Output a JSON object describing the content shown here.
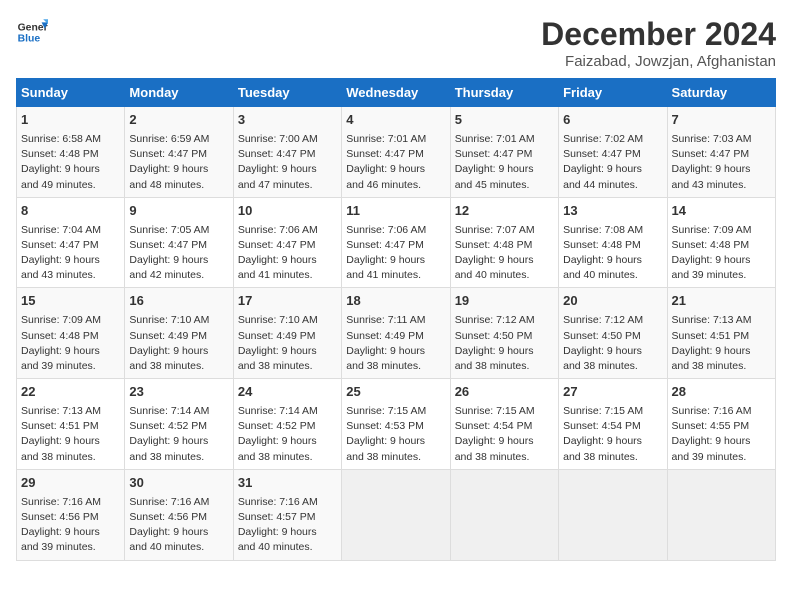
{
  "header": {
    "logo_general": "General",
    "logo_blue": "Blue",
    "title": "December 2024",
    "subtitle": "Faizabad, Jowzjan, Afghanistan"
  },
  "days_of_week": [
    "Sunday",
    "Monday",
    "Tuesday",
    "Wednesday",
    "Thursday",
    "Friday",
    "Saturday"
  ],
  "weeks": [
    [
      {
        "day": 1,
        "info": "Sunrise: 6:58 AM\nSunset: 4:48 PM\nDaylight: 9 hours\nand 49 minutes."
      },
      {
        "day": 2,
        "info": "Sunrise: 6:59 AM\nSunset: 4:47 PM\nDaylight: 9 hours\nand 48 minutes."
      },
      {
        "day": 3,
        "info": "Sunrise: 7:00 AM\nSunset: 4:47 PM\nDaylight: 9 hours\nand 47 minutes."
      },
      {
        "day": 4,
        "info": "Sunrise: 7:01 AM\nSunset: 4:47 PM\nDaylight: 9 hours\nand 46 minutes."
      },
      {
        "day": 5,
        "info": "Sunrise: 7:01 AM\nSunset: 4:47 PM\nDaylight: 9 hours\nand 45 minutes."
      },
      {
        "day": 6,
        "info": "Sunrise: 7:02 AM\nSunset: 4:47 PM\nDaylight: 9 hours\nand 44 minutes."
      },
      {
        "day": 7,
        "info": "Sunrise: 7:03 AM\nSunset: 4:47 PM\nDaylight: 9 hours\nand 43 minutes."
      }
    ],
    [
      {
        "day": 8,
        "info": "Sunrise: 7:04 AM\nSunset: 4:47 PM\nDaylight: 9 hours\nand 43 minutes."
      },
      {
        "day": 9,
        "info": "Sunrise: 7:05 AM\nSunset: 4:47 PM\nDaylight: 9 hours\nand 42 minutes."
      },
      {
        "day": 10,
        "info": "Sunrise: 7:06 AM\nSunset: 4:47 PM\nDaylight: 9 hours\nand 41 minutes."
      },
      {
        "day": 11,
        "info": "Sunrise: 7:06 AM\nSunset: 4:47 PM\nDaylight: 9 hours\nand 41 minutes."
      },
      {
        "day": 12,
        "info": "Sunrise: 7:07 AM\nSunset: 4:48 PM\nDaylight: 9 hours\nand 40 minutes."
      },
      {
        "day": 13,
        "info": "Sunrise: 7:08 AM\nSunset: 4:48 PM\nDaylight: 9 hours\nand 40 minutes."
      },
      {
        "day": 14,
        "info": "Sunrise: 7:09 AM\nSunset: 4:48 PM\nDaylight: 9 hours\nand 39 minutes."
      }
    ],
    [
      {
        "day": 15,
        "info": "Sunrise: 7:09 AM\nSunset: 4:48 PM\nDaylight: 9 hours\nand 39 minutes."
      },
      {
        "day": 16,
        "info": "Sunrise: 7:10 AM\nSunset: 4:49 PM\nDaylight: 9 hours\nand 38 minutes."
      },
      {
        "day": 17,
        "info": "Sunrise: 7:10 AM\nSunset: 4:49 PM\nDaylight: 9 hours\nand 38 minutes."
      },
      {
        "day": 18,
        "info": "Sunrise: 7:11 AM\nSunset: 4:49 PM\nDaylight: 9 hours\nand 38 minutes."
      },
      {
        "day": 19,
        "info": "Sunrise: 7:12 AM\nSunset: 4:50 PM\nDaylight: 9 hours\nand 38 minutes."
      },
      {
        "day": 20,
        "info": "Sunrise: 7:12 AM\nSunset: 4:50 PM\nDaylight: 9 hours\nand 38 minutes."
      },
      {
        "day": 21,
        "info": "Sunrise: 7:13 AM\nSunset: 4:51 PM\nDaylight: 9 hours\nand 38 minutes."
      }
    ],
    [
      {
        "day": 22,
        "info": "Sunrise: 7:13 AM\nSunset: 4:51 PM\nDaylight: 9 hours\nand 38 minutes."
      },
      {
        "day": 23,
        "info": "Sunrise: 7:14 AM\nSunset: 4:52 PM\nDaylight: 9 hours\nand 38 minutes."
      },
      {
        "day": 24,
        "info": "Sunrise: 7:14 AM\nSunset: 4:52 PM\nDaylight: 9 hours\nand 38 minutes."
      },
      {
        "day": 25,
        "info": "Sunrise: 7:15 AM\nSunset: 4:53 PM\nDaylight: 9 hours\nand 38 minutes."
      },
      {
        "day": 26,
        "info": "Sunrise: 7:15 AM\nSunset: 4:54 PM\nDaylight: 9 hours\nand 38 minutes."
      },
      {
        "day": 27,
        "info": "Sunrise: 7:15 AM\nSunset: 4:54 PM\nDaylight: 9 hours\nand 38 minutes."
      },
      {
        "day": 28,
        "info": "Sunrise: 7:16 AM\nSunset: 4:55 PM\nDaylight: 9 hours\nand 39 minutes."
      }
    ],
    [
      {
        "day": 29,
        "info": "Sunrise: 7:16 AM\nSunset: 4:56 PM\nDaylight: 9 hours\nand 39 minutes."
      },
      {
        "day": 30,
        "info": "Sunrise: 7:16 AM\nSunset: 4:56 PM\nDaylight: 9 hours\nand 40 minutes."
      },
      {
        "day": 31,
        "info": "Sunrise: 7:16 AM\nSunset: 4:57 PM\nDaylight: 9 hours\nand 40 minutes."
      },
      null,
      null,
      null,
      null
    ]
  ]
}
